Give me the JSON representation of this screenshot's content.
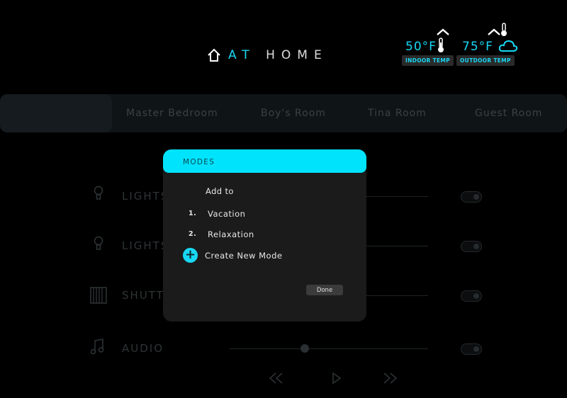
{
  "header": {
    "brand_accent": "AT",
    "brand_rest": "HOME",
    "indoor": {
      "value": "50°F",
      "label": "INDOOR TEMP"
    },
    "outdoor": {
      "value": "75°F",
      "label": "OUTDOOR TEMP"
    }
  },
  "rooms": {
    "items": [
      {
        "label": ""
      },
      {
        "label": "Master Bedroom"
      },
      {
        "label": "Boy's Room"
      },
      {
        "label": "Tina Room"
      },
      {
        "label": "Guest Room"
      }
    ]
  },
  "devices": {
    "items": [
      {
        "label": "LIGHTS",
        "icon": "bulb-icon"
      },
      {
        "label": "LIGHTS",
        "icon": "bulb-icon"
      },
      {
        "label": "SHUTTERS",
        "icon": "shutter-icon"
      },
      {
        "label": "AUDIO",
        "icon": "music-icon"
      }
    ]
  },
  "modal": {
    "title": "MODES",
    "subtitle": "Add to",
    "modes": [
      {
        "num": "1.",
        "label": "Vacation"
      },
      {
        "num": "2.",
        "label": "Relaxation"
      }
    ],
    "create_label": "Create New Mode",
    "done_label": "Done"
  },
  "colors": {
    "accent": "#18d8f5",
    "modal_header": "#00e3fc",
    "modal_bg": "#1b1b1b",
    "background": "#000000"
  }
}
